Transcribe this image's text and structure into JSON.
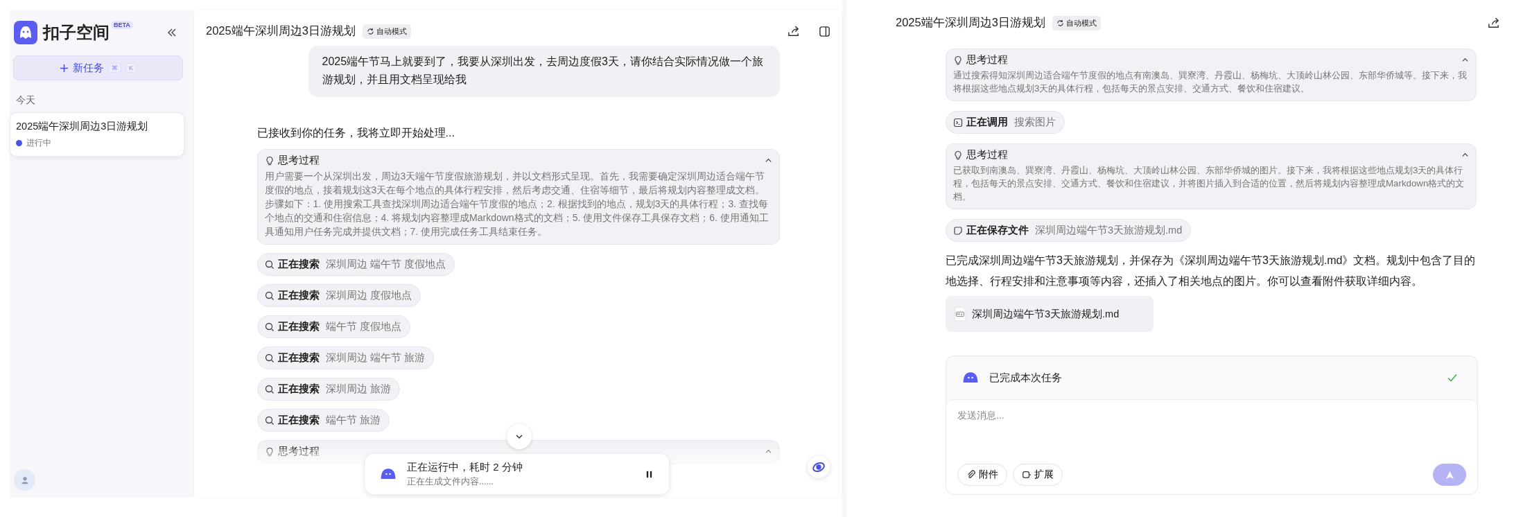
{
  "sidebar": {
    "logo_text": "扣子空间",
    "badge": "BETA",
    "new_task": {
      "label": "新任务",
      "keys": [
        "⌘",
        "K"
      ]
    },
    "section": "今天",
    "tasks": [
      {
        "title": "2025端午深圳周边3日游规划",
        "status": "进行中",
        "selected": true
      }
    ]
  },
  "chat": {
    "title": "2025端午深圳周边3日游规划",
    "mode": "自动模式",
    "user_message": "2025端午节马上就要到了，我要从深圳出发，去周边度假3天，请你结合实际情况做一个旅游规划，并且用文档呈现给我",
    "reply": "已接收到你的任务，我将立即开始处理...",
    "steps": [
      {
        "kind": "thinking",
        "label": "思考过程",
        "expanded": true,
        "text": "用户需要一个从深圳出发，周边3天端午节度假旅游规划，并以文档形式呈现。首先，我需要确定深圳周边适合端午节度假的地点，接着规划这3天在每个地点的具体行程安排，然后考虑交通、住宿等细节，最后将规划内容整理成文档。步骤如下：1. 使用搜索工具查找深圳周边适合端午节度假的地点；2. 根据找到的地点，规划3天的具体行程；3. 查找每个地点的交通和住宿信息；4. 将规划内容整理成Markdown格式的文档；5. 使用文件保存工具保存文档；6. 使用通知工具通知用户任务完成并提供文档；7. 使用完成任务工具结束任务。"
      },
      {
        "kind": "search",
        "label": "正在搜索",
        "detail": "深圳周边 端午节 度假地点"
      },
      {
        "kind": "search",
        "label": "正在搜索",
        "detail": "深圳周边 度假地点"
      },
      {
        "kind": "search",
        "label": "正在搜索",
        "detail": "端午节 度假地点"
      },
      {
        "kind": "search",
        "label": "正在搜索",
        "detail": "深圳周边 端午节 旅游"
      },
      {
        "kind": "search",
        "label": "正在搜索",
        "detail": "深圳周边 旅游"
      },
      {
        "kind": "search",
        "label": "正在搜索",
        "detail": "端午节 旅游"
      },
      {
        "kind": "thinking",
        "label": "思考过程",
        "expanded": true
      }
    ],
    "status": {
      "title": "正在运行中，耗时 2 分钟",
      "subtitle": "正在生成文件内容......"
    }
  },
  "result": {
    "title": "2025端午深圳周边3日游规划",
    "mode": "自动模式",
    "steps": [
      {
        "kind": "thinking",
        "label": "思考过程",
        "expanded": true,
        "text": "通过搜索得知深圳周边适合端午节度假的地点有南澳岛、巽寮湾、丹霞山、杨梅坑、大顶岭山林公园、东部华侨城等。接下来，我将根据这些地点规划3天的具体行程，包括每天的景点安排、交通方式、餐饮和住宿建议。"
      },
      {
        "kind": "tool",
        "label": "正在调用",
        "detail": "搜索图片"
      },
      {
        "kind": "thinking",
        "label": "思考过程",
        "expanded": true,
        "text": "已获取到南澳岛、巽寮湾、丹霞山、杨梅坑、大顶岭山林公园、东部华侨城的图片。接下来，我将根据这些地点规划3天的具体行程，包括每天的景点安排、交通方式、餐饮和住宿建议，并将图片插入到合适的位置，然后将规划内容整理成Markdown格式的文档。"
      },
      {
        "kind": "file",
        "label": "正在保存文件",
        "detail": "深圳周边端午节3天旅游规划.md"
      }
    ],
    "summary": "已完成深圳周边端午节3天旅游规划，并保存为《深圳周边端午节3天旅游规划.md》文档。规划中包含了目的地选择、行程安排和注意事项等内容，还插入了相关地点的图片。你可以查看附件获取详细内容。",
    "attachment": "深圳周边端午节3天旅游规划.md",
    "task_status": {
      "label": "已完成本次任务",
      "done": true
    },
    "input": {
      "placeholder": "发送消息..."
    },
    "buttons": [
      {
        "kind": "attach",
        "label": "附件"
      },
      {
        "kind": "extend",
        "label": "扩展"
      }
    ],
    "send": {
      "disabled": true
    }
  }
}
